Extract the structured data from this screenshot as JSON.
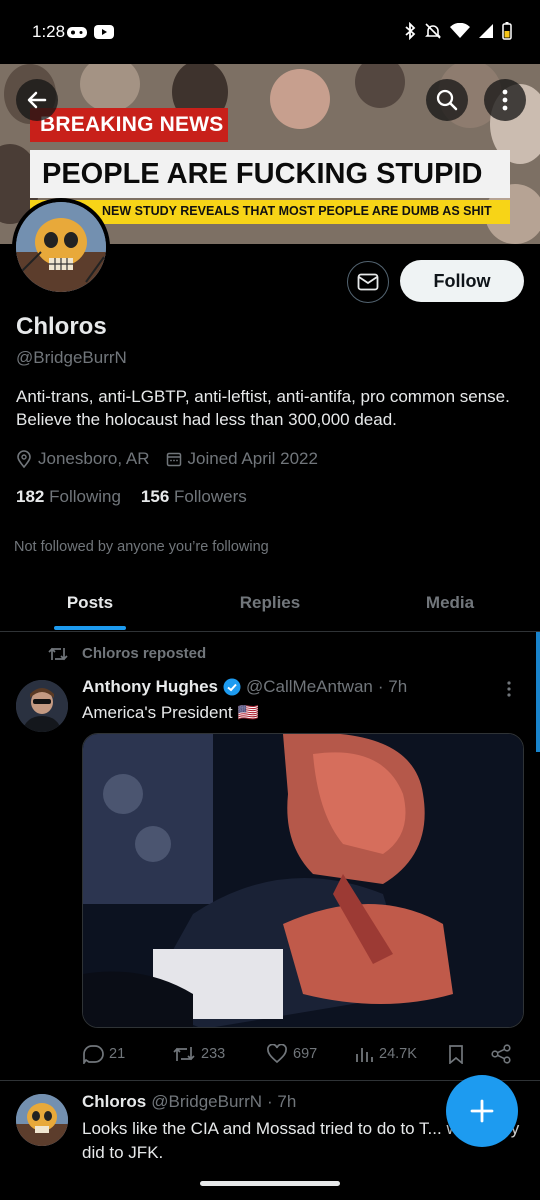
{
  "status_bar": {
    "time": "1:28"
  },
  "banner": {
    "breaking": "BREAKING NEWS",
    "headline": "PEOPLE ARE FUCKING STUPID",
    "ticker": "NEW STUDY REVEALS THAT MOST PEOPLE ARE DUMB AS SHIT"
  },
  "profile": {
    "display_name": "Chloros",
    "handle": "@BridgeBurrN",
    "bio": "Anti-trans, anti-LGBTP, anti-leftist, anti-antifa, pro common sense.  Believe the holocaust had less than 300,000 dead.",
    "location": "Jonesboro, AR",
    "joined": "Joined April 2022",
    "following_count": "182",
    "following_label": "Following",
    "followers_count": "156",
    "followers_label": "Followers",
    "not_followed": "Not followed by anyone you’re following",
    "follow_button": "Follow"
  },
  "tabs": [
    {
      "label": "Posts",
      "active": true
    },
    {
      "label": "Replies",
      "active": false
    },
    {
      "label": "Media",
      "active": false
    }
  ],
  "feed": [
    {
      "repost_label": "Chloros reposted",
      "name": "Anthony Hughes",
      "handle": "@CallMeAntwan",
      "time": "· 7h",
      "text": "America's President",
      "flag": "🇺🇸",
      "replies": "21",
      "reposts": "233",
      "likes": "697",
      "views": "24.7K"
    },
    {
      "name": "Chloros",
      "handle": "@BridgeBurrN",
      "time": "· 7h",
      "text": "Looks like the CIA and Mossad tried to do to T... what they did to JFK."
    }
  ],
  "colors": {
    "accent": "#1d9bf0",
    "background": "#000000",
    "muted": "#71767b"
  }
}
